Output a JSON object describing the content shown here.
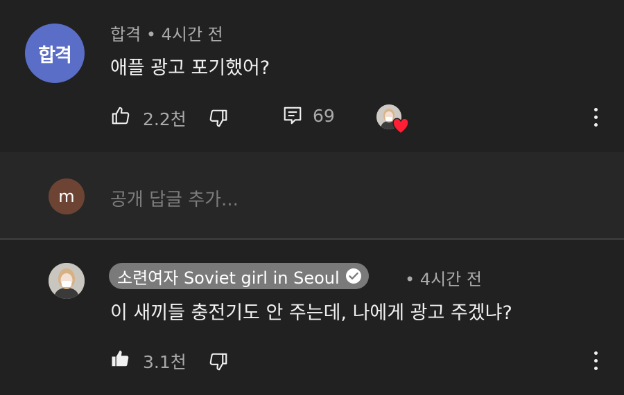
{
  "comments": [
    {
      "avatar_text": "합격",
      "author": "합격",
      "separator": "•",
      "time": "4시간 전",
      "text": "애플 광고 포기했어?",
      "likes": "2.2천",
      "replies": "69",
      "creator_heart": true,
      "accent_color": "#5a6ec8"
    },
    {
      "author": "소련여자 Soviet girl in Seoul",
      "verified": true,
      "separator": "•",
      "time": "4시간 전",
      "text": "이 새끼들 충전기도 안 주는데, 나에게 광고 주겠냐?",
      "likes": "3.1천",
      "liked": true
    }
  ],
  "reply_box": {
    "avatar_text": "m",
    "placeholder": "공개 답글 추가..."
  },
  "icons": [
    "thumbs-up-icon",
    "thumbs-down-icon",
    "reply-icon",
    "heart-icon",
    "more-vert-icon",
    "verified-icon"
  ]
}
